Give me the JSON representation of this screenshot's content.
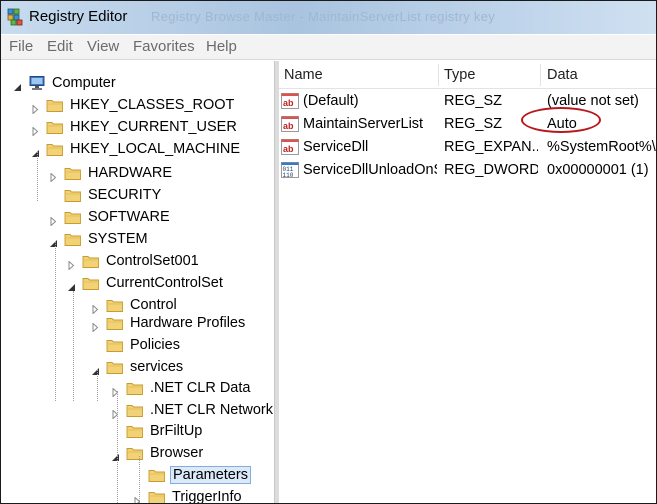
{
  "window": {
    "title": "Registry Editor",
    "ghost_title": "Registry Browse Master - MaintainServerList registry key"
  },
  "menu": [
    "File",
    "Edit",
    "View",
    "Favorites",
    "Help"
  ],
  "tree": [
    {
      "label": "Computer",
      "expanded": true
    },
    {
      "label": "HKEY_CLASSES_ROOT"
    },
    {
      "label": "HKEY_CURRENT_USER"
    },
    {
      "label": "HKEY_LOCAL_MACHINE",
      "expanded": true
    },
    {
      "label": "HARDWARE"
    },
    {
      "label": "SECURITY"
    },
    {
      "label": "SOFTWARE"
    },
    {
      "label": "SYSTEM",
      "expanded": true
    },
    {
      "label": "ControlSet001"
    },
    {
      "label": "CurrentControlSet",
      "expanded": true
    },
    {
      "label": "Control"
    },
    {
      "label": "Hardware Profiles"
    },
    {
      "label": "Policies"
    },
    {
      "label": "services",
      "expanded": true
    },
    {
      "label": ".NET CLR Data"
    },
    {
      "label": ".NET CLR Network"
    },
    {
      "label": "BrFiltUp"
    },
    {
      "label": "Browser",
      "expanded": true
    },
    {
      "label": "Parameters",
      "selected": true
    },
    {
      "label": "TriggerInfo"
    }
  ],
  "list": {
    "headers": {
      "name": "Name",
      "type": "Type",
      "data": "Data"
    },
    "rows": [
      {
        "name": "(Default)",
        "type": "REG_SZ",
        "data": "(value not set)",
        "icon": "string-value-icon"
      },
      {
        "name": "MaintainServerList",
        "type": "REG_SZ",
        "data": "Auto",
        "icon": "string-value-icon"
      },
      {
        "name": "ServiceDll",
        "type": "REG_EXPAN...",
        "data": "%SystemRoot%\\",
        "icon": "string-value-icon"
      },
      {
        "name": "ServiceDllUnloadOnStop",
        "type": "REG_DWORD",
        "data": "0x00000001 (1)",
        "icon": "dword-value-icon"
      }
    ]
  },
  "colors": {
    "highlight_oval": "#b8181c",
    "folder": "#f2d276",
    "selection": "#dbe9f8"
  }
}
